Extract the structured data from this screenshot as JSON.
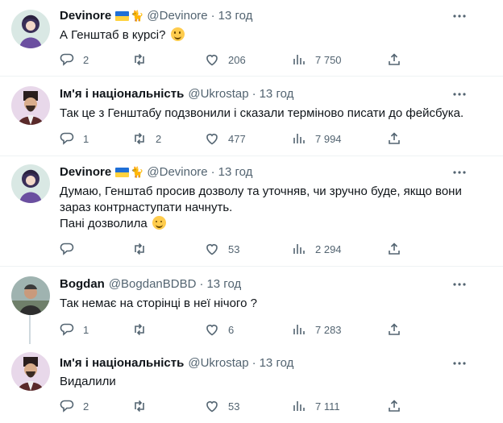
{
  "tweets": [
    {
      "name": "Devinore",
      "handle": "@Devinore",
      "time": "13 год",
      "text": "А Генштаб в курсі? ",
      "emoji": "sweat-smile",
      "replies": "2",
      "retweets": "",
      "likes": "206",
      "views": "7 750",
      "flag": true
    },
    {
      "name": "Ім'я і національність",
      "handle": "@Ukrostap",
      "time": "13 год",
      "text": "Так це з Генштабу подзвонили і сказали терміново писати до фейсбука.",
      "replies": "1",
      "retweets": "2",
      "likes": "477",
      "views": "7 994",
      "flag": false
    },
    {
      "name": "Devinore",
      "handle": "@Devinore",
      "time": "13 год",
      "text": "Думаю, Генштаб просив дозволу та уточняв, чи зручно буде, якщо вони зараз контрнаступати начнуть.\nПані дозволила ",
      "emoji": "smiling-blush",
      "replies": "",
      "retweets": "",
      "likes": "53",
      "views": "2 294",
      "flag": true
    },
    {
      "name": "Bogdan",
      "handle": "@BogdanBDBD",
      "time": "13 год",
      "text": "Так немає на сторінці в неї нічого ?",
      "replies": "1",
      "retweets": "",
      "likes": "6",
      "views": "7 283",
      "flag": false
    },
    {
      "name": "Ім'я і національність",
      "handle": "@Ukrostap",
      "time": "13 год",
      "text": "Видалили",
      "replies": "2",
      "retweets": "",
      "likes": "53",
      "views": "7 111",
      "flag": false
    }
  ],
  "separator": "·",
  "icons": {
    "more": "more-horizontal-icon",
    "reply": "reply-icon",
    "retweet": "retweet-icon",
    "like": "heart-icon",
    "views": "views-chart-icon",
    "share": "share-icon",
    "flag": "ukraine-flag-icon",
    "cat": "cat-icon"
  },
  "colors": {
    "text": "#0f1419",
    "secondary": "#536471",
    "divider": "#eff3f4",
    "thread_line": "#cfd9de",
    "flag_blue": "#1f6fd6",
    "flag_yellow": "#ffd23f"
  }
}
